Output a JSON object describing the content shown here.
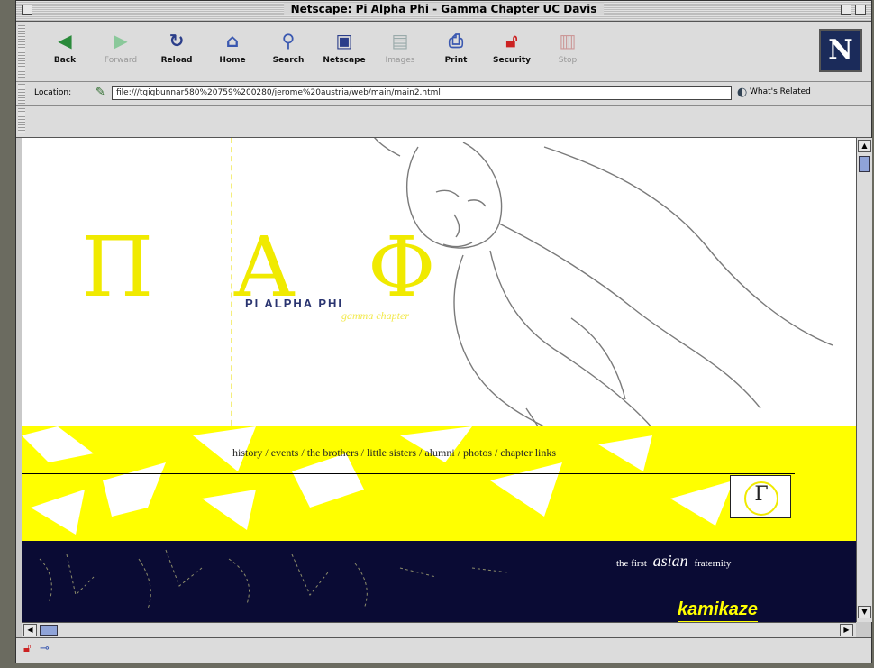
{
  "window": {
    "title": "Netscape: Pi Alpha Phi - Gamma Chapter UC Davis"
  },
  "toolbar": {
    "buttons": [
      {
        "label": "Back",
        "icon": "back-arrow-icon"
      },
      {
        "label": "Forward",
        "icon": "forward-arrow-icon"
      },
      {
        "label": "Reload",
        "icon": "reload-icon"
      },
      {
        "label": "Home",
        "icon": "home-icon"
      },
      {
        "label": "Search",
        "icon": "search-icon"
      },
      {
        "label": "Netscape",
        "icon": "netscape-icon"
      },
      {
        "label": "Images",
        "icon": "images-icon"
      },
      {
        "label": "Print",
        "icon": "print-icon"
      },
      {
        "label": "Security",
        "icon": "lock-icon"
      },
      {
        "label": "Stop",
        "icon": "stop-icon"
      }
    ],
    "logo": "N"
  },
  "location": {
    "label": "Location:",
    "url": "file:///tgigbunnar580%20759%200280/jerome%20austria/web/main/main2.html",
    "related": "What's Related"
  },
  "page": {
    "greek_letters": [
      "Π",
      "Α",
      "Φ"
    ],
    "brand": "PI ALPHA PHI",
    "subbrand": "gamma chapter",
    "nav": [
      "history",
      "events",
      "the brothers",
      "little sisters",
      "alumni",
      "photos",
      "chapter links"
    ],
    "gamma_symbol": "Γ",
    "tagline": {
      "pre": "the first",
      "emph": "asian",
      "post": "fraternity"
    },
    "kamikaze": "kamikaze"
  },
  "colors": {
    "accent_yellow": "#ffff00",
    "navy": "#0a0b34"
  }
}
